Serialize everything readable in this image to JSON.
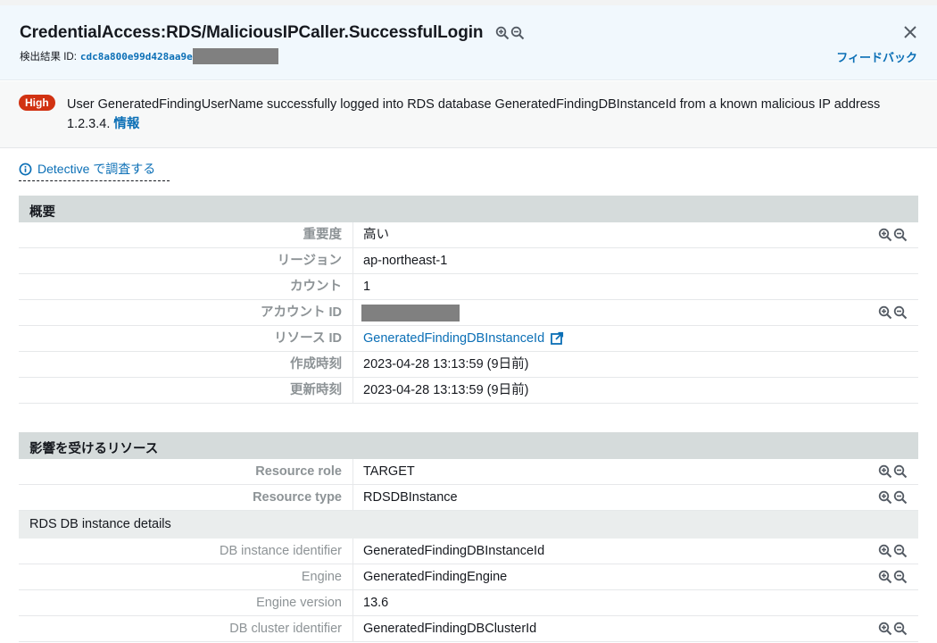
{
  "header": {
    "title": "CredentialAccess:RDS/MaliciousIPCaller.SuccessfulLogin",
    "finding_id_label": "検出結果 ID:",
    "finding_id_value": "cdc8a800e99d428aa9e",
    "feedback_label": "フィードバック"
  },
  "alert": {
    "severity": "High",
    "message": "User GeneratedFindingUserName successfully logged into RDS database GeneratedFindingDBInstanceId from a known malicious IP address 1.2.3.4.",
    "info_link": "情報"
  },
  "detective_link": "Detective で調査する",
  "overview": {
    "heading": "概要",
    "rows": [
      {
        "key": "重要度",
        "value": "高い"
      },
      {
        "key": "リージョン",
        "value": "ap-northeast-1"
      },
      {
        "key": "カウント",
        "value": "1"
      },
      {
        "key": "アカウント ID",
        "value": ""
      },
      {
        "key": "リソース ID",
        "value": "GeneratedFindingDBInstanceId"
      },
      {
        "key": "作成時刻",
        "value": "2023-04-28 13:13:59 (9日前)"
      },
      {
        "key": "更新時刻",
        "value": "2023-04-28 13:13:59 (9日前)"
      }
    ]
  },
  "affected": {
    "heading": "影響を受けるリソース",
    "rows": [
      {
        "key": "Resource role",
        "value": "TARGET"
      },
      {
        "key": "Resource type",
        "value": "RDSDBInstance"
      }
    ],
    "subheading": "RDS DB instance details",
    "db_rows": [
      {
        "key": "DB instance identifier",
        "value": "GeneratedFindingDBInstanceId"
      },
      {
        "key": "Engine",
        "value": "GeneratedFindingEngine"
      },
      {
        "key": "Engine version",
        "value": "13.6"
      },
      {
        "key": "DB cluster identifier",
        "value": "GeneratedFindingDBClusterId"
      }
    ]
  },
  "colors": {
    "link": "#0b6fb6",
    "severity_high": "#d13212",
    "header_bg": "#f1f8fd",
    "section_bg": "#d5dbdb"
  }
}
